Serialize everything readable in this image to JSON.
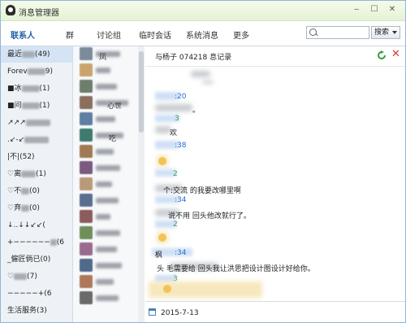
{
  "window": {
    "title": "消息管理器",
    "controls": [
      "‒",
      "☐",
      "✕"
    ]
  },
  "tabs": [
    {
      "label": "联系人",
      "active": true
    },
    {
      "label": "群"
    },
    {
      "label": "讨论组"
    },
    {
      "label": "临时会话"
    },
    {
      "label": "系统消息"
    },
    {
      "label": "更多"
    }
  ],
  "search": {
    "placeholder": "",
    "button_label": "搜索",
    "icon": "search-icon"
  },
  "groups": [
    {
      "prefix": "最近",
      "suffix": "(49)",
      "selected": true
    },
    {
      "prefix": "Forev",
      "suffix": "9)"
    },
    {
      "prefix": "■冰",
      "suffix": "(1)"
    },
    {
      "prefix": "■问",
      "suffix": "(1)"
    },
    {
      "prefix": "↗↗↗",
      "suffix": ""
    },
    {
      "prefix": ".↙-↙",
      "suffix": ""
    },
    {
      "prefix": "|不|",
      "suffix": "(52)"
    },
    {
      "prefix": "♡离",
      "suffix": "(1)"
    },
    {
      "prefix": "♡不",
      "suffix": "(0)"
    },
    {
      "prefix": "♡弃",
      "suffix": "(0)"
    },
    {
      "prefix": "↓..↓↓↙↙(",
      "suffix": ""
    },
    {
      "prefix": "+−−−−−−",
      "suffix": "(6"
    },
    {
      "prefix": "_僱匠倘已",
      "suffix": "(0)"
    },
    {
      "prefix": "♡",
      "suffix": "(7)"
    },
    {
      "prefix": "−−−−−+",
      "suffix": "(6"
    },
    {
      "prefix": "生活服务",
      "suffix": "(3)"
    }
  ],
  "friends": [
    {
      "avatar_color": "#7c8b9c"
    },
    {
      "avatar_color": "#c9a56b"
    },
    {
      "avatar_color": "#6d7e6a"
    },
    {
      "avatar_color": "#8a6f5e"
    },
    {
      "avatar_color": "#5f7fa3"
    },
    {
      "avatar_color": "#3e7a6e"
    },
    {
      "avatar_color": "#a17a55"
    },
    {
      "avatar_color": "#7a5a7e"
    },
    {
      "avatar_color": "#b89a7a"
    },
    {
      "avatar_color": "#5a6f8f"
    },
    {
      "avatar_color": "#8c5b5b"
    },
    {
      "avatar_color": "#6f8f5a"
    },
    {
      "avatar_color": "#9a6b8e"
    },
    {
      "avatar_color": "#4f6a8a"
    },
    {
      "avatar_color": "#b0785a"
    },
    {
      "avatar_color": "#6a6a6a"
    }
  ],
  "friend_fragments": {
    "f1": "凤",
    "f4": "心世",
    "f6": "吃"
  },
  "chat": {
    "title": "与杨子 074218 息记录",
    "messages": [
      {
        "time": ":20"
      },
      {
        "text": "。"
      },
      {
        "time": "3"
      },
      {
        "text": "欢"
      },
      {
        "time": ":38"
      },
      {
        "time": "2"
      },
      {
        "text": "个:交流 的我要改哪里啊"
      },
      {
        "time": ":34"
      },
      {
        "text": "说不用 回头他改就行了。"
      },
      {
        "time": "2"
      },
      {
        "sender": "枫",
        "time": ":34"
      },
      {
        "text": "头 毛需要给 回头我让洪思把设计图设计好给你。"
      },
      {
        "time": "3"
      }
    ],
    "date": "2015-7-13"
  }
}
